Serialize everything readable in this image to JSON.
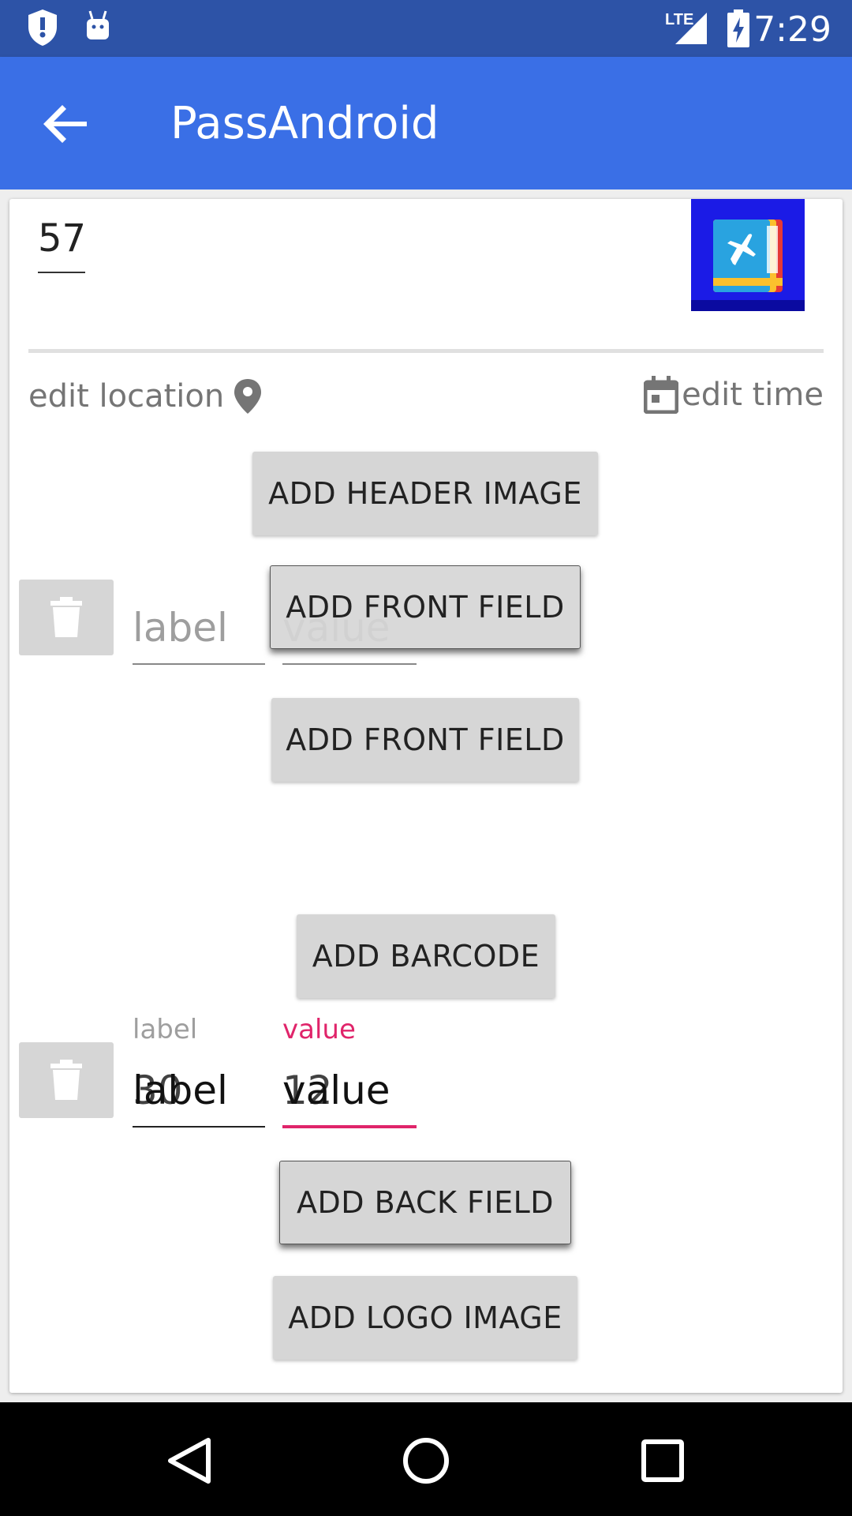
{
  "status_bar": {
    "time": "7:29",
    "network": "LTE",
    "icons": [
      "shield-alert-icon",
      "android-icon",
      "signal-icon",
      "battery-charging-icon"
    ]
  },
  "app_bar": {
    "title": "PassAndroid",
    "back_icon": "arrow-back-icon",
    "color": "#3a6fe6"
  },
  "pass": {
    "description": "57",
    "icon_image": "airplane-pass-icon"
  },
  "actions": {
    "edit_location": "edit location",
    "edit_time": "edit time"
  },
  "buttons": {
    "add_header_image": "ADD HEADER IMAGE",
    "add_front_field_overlay": "ADD FRONT FIELD",
    "add_front_field": "ADD FRONT FIELD",
    "add_barcode": "ADD BARCODE",
    "add_back_field": "ADD BACK FIELD",
    "add_logo_image": "ADD LOGO IMAGE"
  },
  "front_field": {
    "label_placeholder": "label",
    "value_placeholder": "value"
  },
  "back_field": {
    "label_hint": "label",
    "value_hint": "value",
    "label_text": "label",
    "label_overlap_text": "30",
    "value_text": "value",
    "value_overlap_text": "12",
    "accent_color": "#e0246a"
  },
  "nav_bar": {
    "back": "back-triangle-icon",
    "home": "home-circle-icon",
    "recents": "recents-square-icon"
  }
}
